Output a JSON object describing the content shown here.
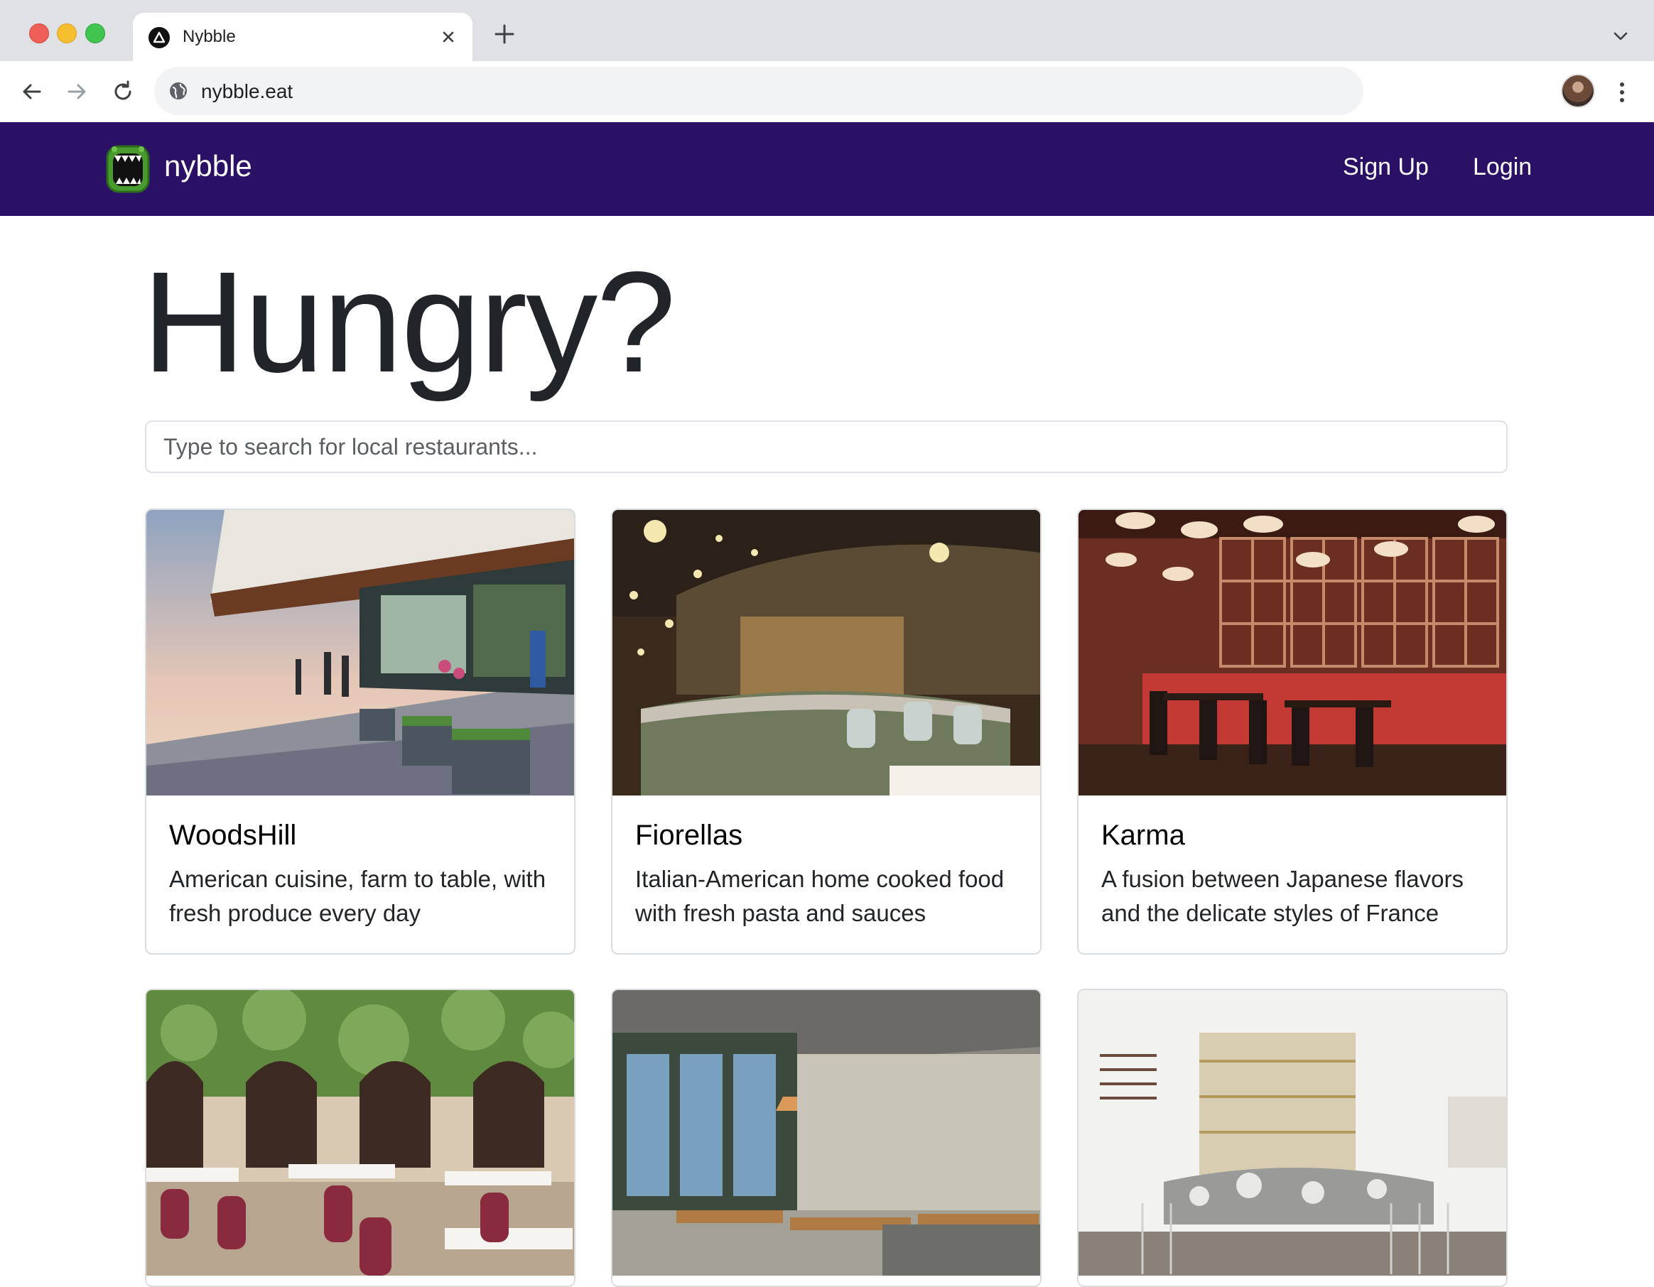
{
  "browser": {
    "tab_title": "Nybble",
    "url": "nybble.eat"
  },
  "navbar": {
    "brand": "nybble",
    "signup": "Sign Up",
    "login": "Login",
    "background": "#2b1166"
  },
  "hero": {
    "title": "Hungry?"
  },
  "search": {
    "placeholder": "Type to search for local restaurants...",
    "value": ""
  },
  "restaurants": [
    {
      "name": "WoodsHill",
      "description": "American cuisine, farm to table, with fresh produce every day",
      "image": "waterfront-patio-photo"
    },
    {
      "name": "Fiorellas",
      "description": "Italian-American home cooked food with fresh pasta and sauces",
      "image": "bar-interior-photo"
    },
    {
      "name": "Karma",
      "description": "A fusion between Japanese flavors and the delicate styles of France",
      "image": "red-booth-dining-photo"
    },
    {
      "name": "",
      "description": "",
      "image": "ivy-courtyard-photo"
    },
    {
      "name": "",
      "description": "",
      "image": "industrial-dining-hall-photo"
    },
    {
      "name": "",
      "description": "",
      "image": "marble-bar-photo"
    }
  ]
}
